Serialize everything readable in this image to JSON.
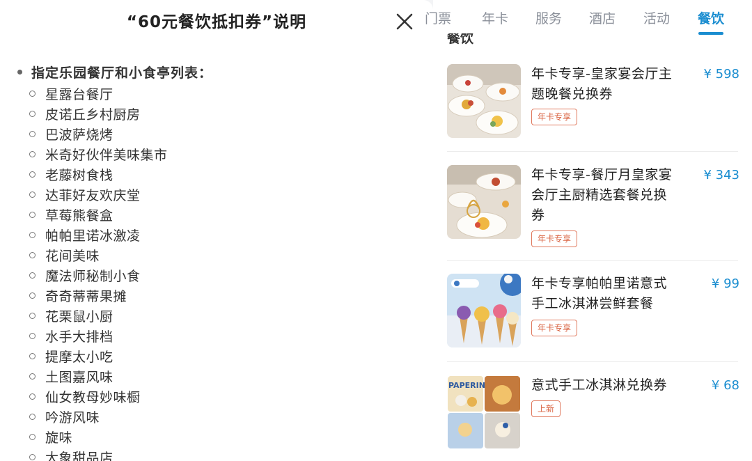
{
  "modal": {
    "title": "“60元餐饮抵扣券”说明",
    "close_icon": "close-icon",
    "list_heading": "指定乐园餐厅和小食亭列表：",
    "restaurants": [
      "星露台餐厅",
      "皮诺丘乡村厨房",
      "巴波萨烧烤",
      "米奇好伙伴美味集市",
      "老藤树食栈",
      "达菲好友欢庆堂",
      "草莓熊餐盒",
      "帕帕里诺冰激凌",
      "花间美味",
      "魔法师秘制小食",
      "奇奇蒂蒂果摊",
      "花栗鼠小厨",
      "水手大排档",
      "提摩太小吃",
      "土图嘉风味",
      "仙女教母妙味橱",
      "吟游风味",
      "旋味",
      "大象甜品店"
    ]
  },
  "tabs": {
    "items": [
      "门票",
      "年卡",
      "服务",
      "酒店",
      "活动",
      "餐饮"
    ],
    "active": "餐饮"
  },
  "section": {
    "label": "餐饮"
  },
  "products": [
    {
      "name": "年卡专享-皇家宴会厅主题晚餐兑换券",
      "price": "¥ 598",
      "badge": "年卡专享",
      "image_icon": "dinner-plates-image"
    },
    {
      "name": "年卡专享-餐厅月皇家宴会厅主厨精选套餐兑换券",
      "price": "¥ 343",
      "badge": "年卡专享",
      "image_icon": "carriage-dessert-image"
    },
    {
      "name": "年卡专享帕帕里诺意式手工冰淇淋尝鲜套餐",
      "price": "¥ 99",
      "badge": "年卡专享",
      "image_icon": "ice-cream-cones-image"
    },
    {
      "name": "意式手工冰淇淋兑换券",
      "price": "¥ 68",
      "badge": "上新",
      "image_icon": "gelato-collage-image"
    }
  ],
  "colors": {
    "accent": "#1a8dd0",
    "badge": "#d9613f",
    "text": "#222222"
  }
}
